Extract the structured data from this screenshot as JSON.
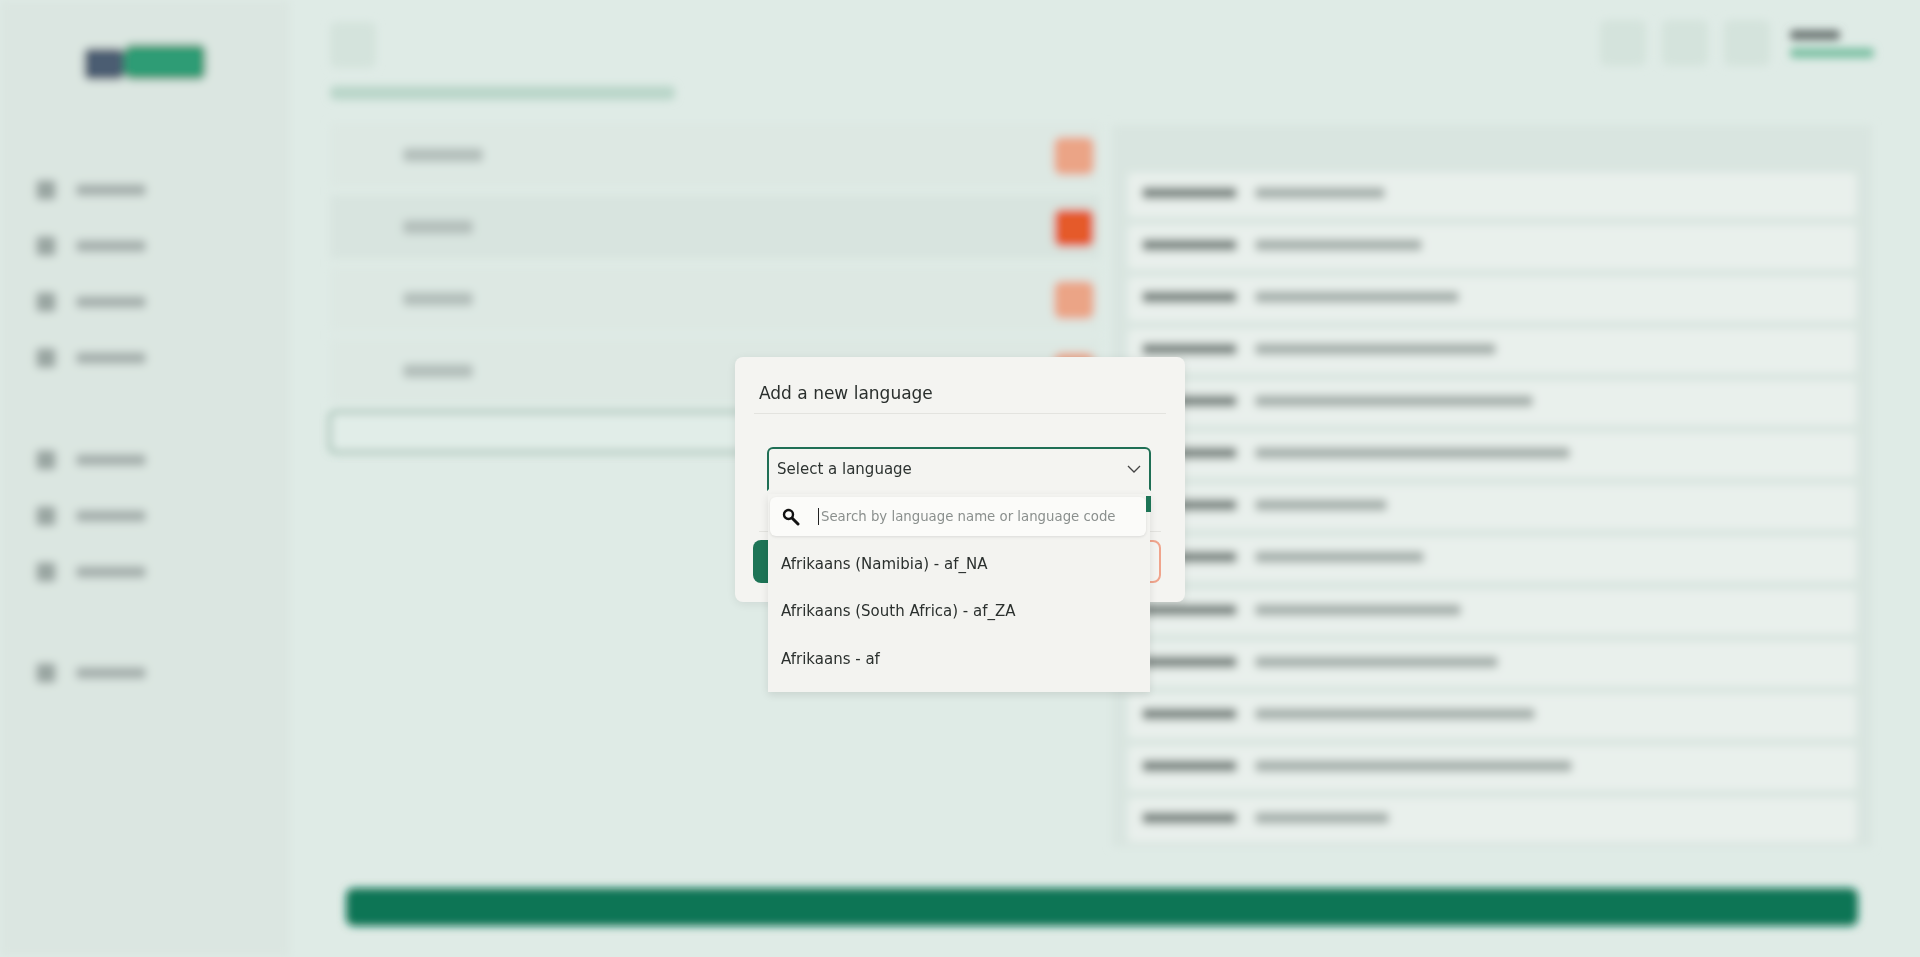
{
  "dialog": {
    "title": "Add a new language",
    "select": {
      "placeholder": "Select a language",
      "expanded": true
    },
    "search": {
      "placeholder": "Search by language name or language code"
    },
    "options": [
      {
        "label": "Afrikaans (Namibia) - af_NA",
        "selected": false
      },
      {
        "label": "Afrikaans (South Africa) - af_ZA",
        "selected": false
      },
      {
        "label": "Afrikaans - af",
        "selected": false
      }
    ]
  }
}
